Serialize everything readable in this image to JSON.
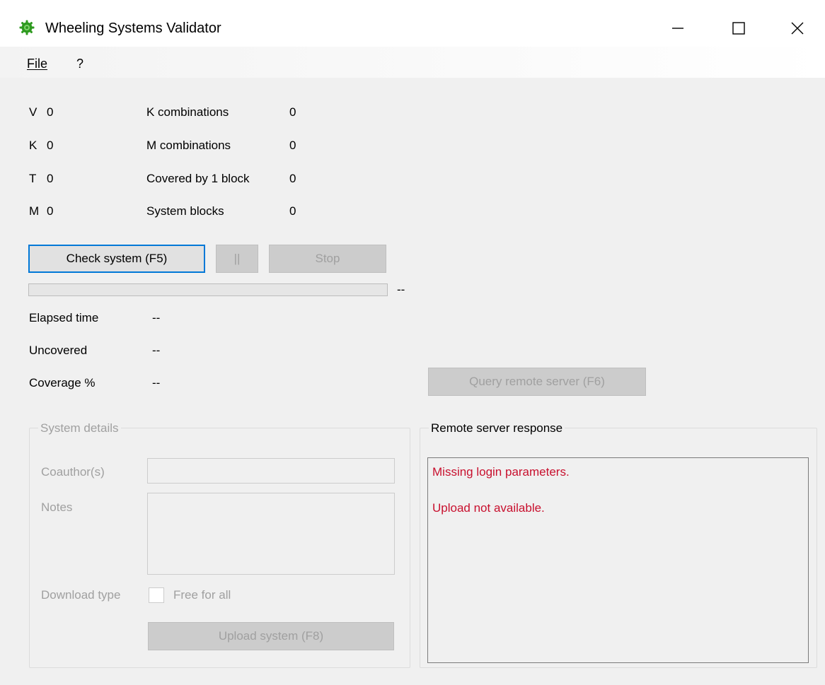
{
  "window": {
    "title": "Wheeling Systems Validator",
    "app_icon": "green-gear-icon",
    "controls": [
      "minimize-icon",
      "maximize-icon",
      "close-icon"
    ]
  },
  "menu": {
    "file": "File",
    "help": "?"
  },
  "params": [
    {
      "name": "V",
      "value": "0"
    },
    {
      "name": "K",
      "value": "0"
    },
    {
      "name": "T",
      "value": "0"
    },
    {
      "name": "M",
      "value": "0"
    }
  ],
  "stats": [
    {
      "label": "K combinations",
      "value": "0"
    },
    {
      "label": "M combinations",
      "value": "0"
    },
    {
      "label": "Covered by 1 block",
      "value": "0"
    },
    {
      "label": "System blocks",
      "value": "0"
    }
  ],
  "buttons": {
    "check": "Check system (F5)",
    "pause": "||",
    "stop": "Stop",
    "query": "Query remote server (F6)",
    "upload": "Upload system (F8)"
  },
  "progress": {
    "percent": 0,
    "text": "--"
  },
  "results": [
    {
      "label": "Elapsed time",
      "value": "--"
    },
    {
      "label": "Uncovered",
      "value": "--"
    },
    {
      "label": "Coverage %",
      "value": "--"
    }
  ],
  "details": {
    "title": "System details",
    "coauthors_label": "Coauthor(s)",
    "coauthors_value": "",
    "notes_label": "Notes",
    "notes_value": "",
    "download_label": "Download type",
    "free_label": "Free for all",
    "free_checked": false
  },
  "response": {
    "title": "Remote server response",
    "lines": [
      "Missing login parameters.",
      "Upload not available."
    ],
    "color": "#c8102e"
  },
  "colors": {
    "accent": "#0078d7",
    "app_icon": "#2e9a1f"
  }
}
